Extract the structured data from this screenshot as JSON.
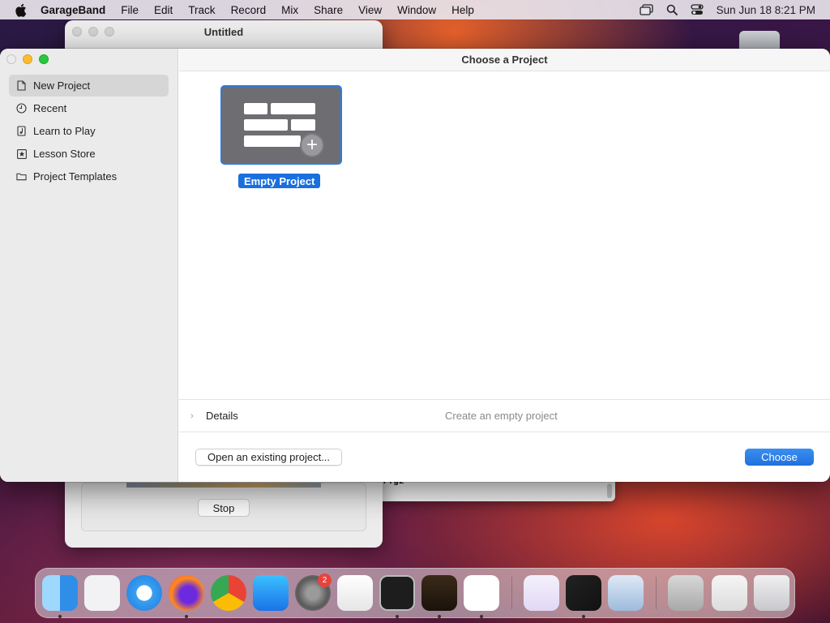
{
  "menubar": {
    "app": "GarageBand",
    "items": [
      "File",
      "Edit",
      "Track",
      "Record",
      "Mix",
      "Share",
      "View",
      "Window",
      "Help"
    ],
    "clock": "Sun Jun 18  8:21 PM"
  },
  "background_window": {
    "title": "Untitled",
    "stop_label": "Stop"
  },
  "terminal_window": {
    "text": "r.gz"
  },
  "dialog": {
    "title": "Choose a Project",
    "sidebar": {
      "items": [
        {
          "label": "New Project",
          "icon": "document-icon",
          "selected": true
        },
        {
          "label": "Recent",
          "icon": "clock-icon",
          "selected": false
        },
        {
          "label": "Learn to Play",
          "icon": "music-note-icon",
          "selected": false
        },
        {
          "label": "Lesson Store",
          "icon": "star-icon",
          "selected": false
        },
        {
          "label": "Project Templates",
          "icon": "folder-icon",
          "selected": false
        }
      ]
    },
    "project_tile": {
      "label": "Empty Project",
      "selected": true
    },
    "details": {
      "label": "Details",
      "description": "Create an empty project"
    },
    "open_existing_label": "Open an existing project...",
    "choose_label": "Choose"
  },
  "dock": {
    "apps": [
      "Finder",
      "Launchpad",
      "Safari",
      "Firefox",
      "Chrome",
      "App Store",
      "System Preferences",
      "TextEdit",
      "Terminal",
      "GarageBand",
      "Visual Studio Code",
      "Visual Studio",
      "Final Cut",
      "Preview",
      "Window",
      "Chrome Window",
      "Trash"
    ],
    "settings_badge": "2"
  },
  "colors": {
    "accent": "#1f71e0",
    "selection_bg": "#d6d6d6"
  }
}
